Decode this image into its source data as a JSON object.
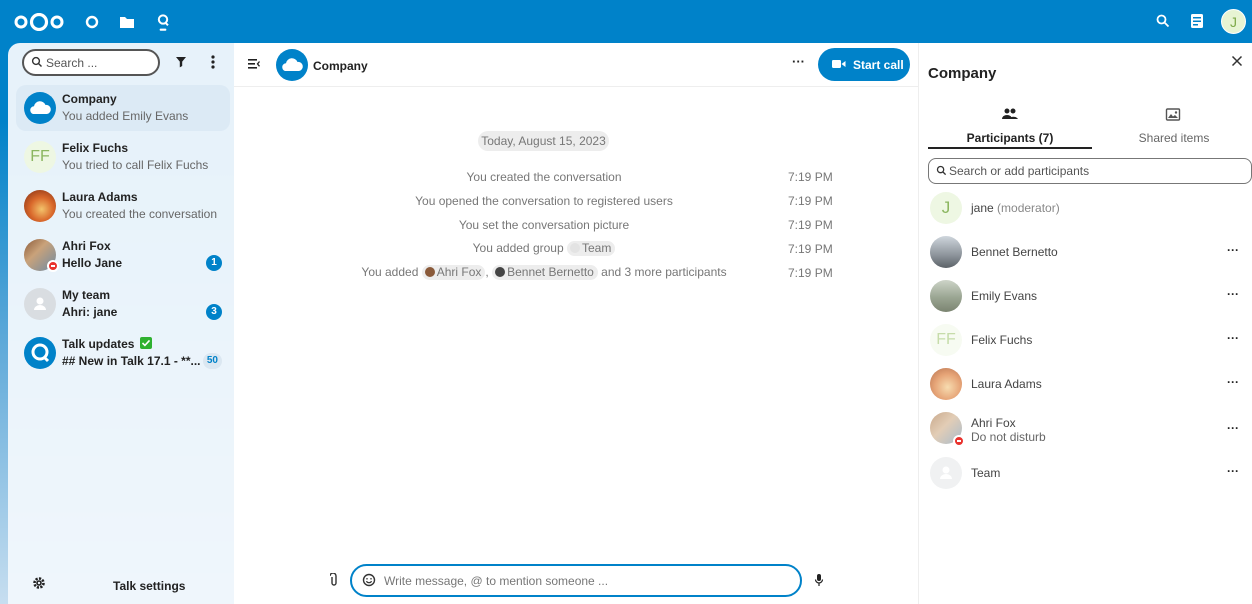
{
  "topbar": {
    "apps": [
      "dashboard-icon",
      "files-icon",
      "talk-icon"
    ],
    "user_initial": "J"
  },
  "nav": {
    "search_placeholder": "Search ...",
    "conversations": [
      {
        "name": "Company",
        "subtitle": "You added Emily Evans",
        "active": true
      },
      {
        "name": "Felix Fuchs",
        "subtitle": "You tried to call Felix Fuchs",
        "avatar_initials": "FF"
      },
      {
        "name": "Laura Adams",
        "subtitle": "You created the conversation"
      },
      {
        "name": "Ahri Fox",
        "subtitle": "Hello Jane",
        "unread": "1",
        "status": "do-not-disturb"
      },
      {
        "name": "My team",
        "subtitle": "Ahri: jane",
        "unread": "3"
      },
      {
        "name": "Talk updates",
        "subtitle": "## New in Talk 17.1 - **...",
        "unread": "50",
        "verified": true
      }
    ],
    "settings_label": "Talk settings"
  },
  "chat": {
    "title": "Company",
    "start_call": "Start call",
    "date": "Today, August 15, 2023",
    "messages": [
      {
        "text": "You created the conversation",
        "time": "7:19 PM"
      },
      {
        "text": "You opened the conversation to registered users",
        "time": "7:19 PM"
      },
      {
        "text": "You set the conversation picture",
        "time": "7:19 PM"
      },
      {
        "text_before": "You added group",
        "chip": "Team",
        "time": "7:19 PM"
      },
      {
        "text_before": "You added",
        "chip1": "Ahri Fox",
        "sep": ",",
        "chip2": "Bennet Bernetto",
        "text_after": "and 3 more participants",
        "time": "7:19 PM"
      }
    ],
    "composer_placeholder": "Write message, @ to mention someone ..."
  },
  "sidebar": {
    "title": "Company",
    "tabs": [
      {
        "label": "Participants (7)",
        "active": true
      },
      {
        "label": "Shared items",
        "active": false
      }
    ],
    "search_placeholder": "Search or add participants",
    "participants": [
      {
        "name": "jane",
        "role": "(moderator)",
        "initial": "J"
      },
      {
        "name": "Bennet Bernetto"
      },
      {
        "name": "Emily Evans"
      },
      {
        "name": "Felix Fuchs",
        "initials": "FF"
      },
      {
        "name": "Laura Adams"
      },
      {
        "name": "Ahri Fox",
        "status": "Do not disturb"
      },
      {
        "name": "Team"
      }
    ]
  },
  "colors": {
    "primary": "#0082c9",
    "dnd": "#e9322d",
    "verified": "#2fb130"
  }
}
